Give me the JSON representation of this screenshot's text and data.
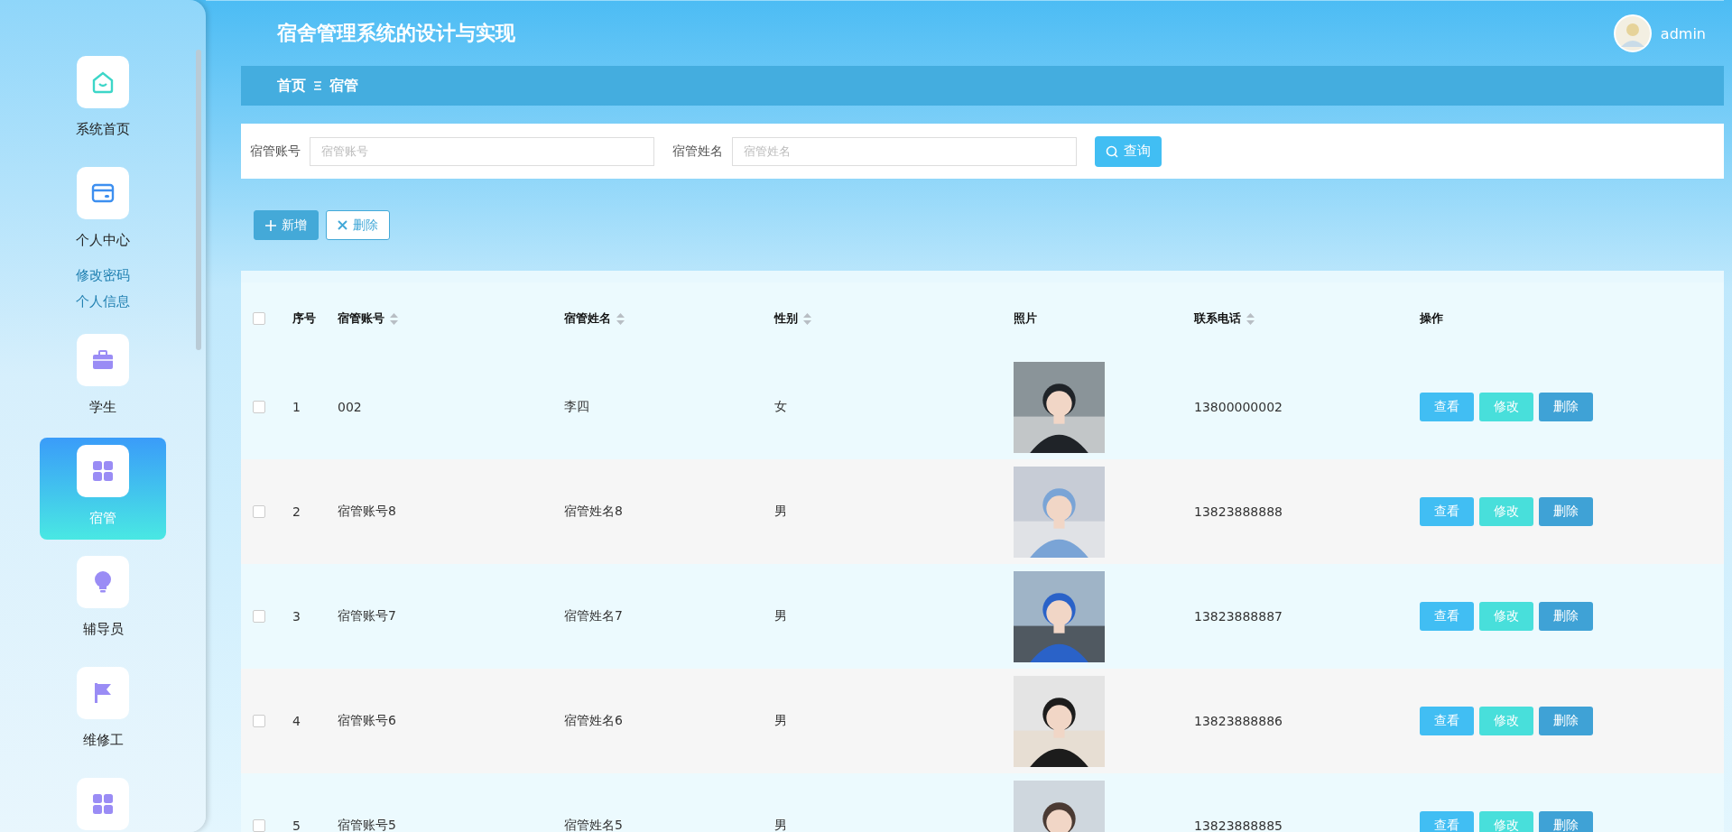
{
  "header": {
    "title": "宿舍管理系统的设计与实现",
    "user": "admin"
  },
  "sidebar": {
    "items": [
      {
        "label": "系统首页",
        "selected": false
      },
      {
        "label": "个人中心",
        "selected": false,
        "children": [
          {
            "label": "修改密码"
          },
          {
            "label": "个人信息"
          }
        ]
      },
      {
        "label": "学生",
        "selected": false
      },
      {
        "label": "宿管",
        "selected": true
      },
      {
        "label": "辅导员",
        "selected": false
      },
      {
        "label": "维修工",
        "selected": false
      },
      {
        "selected": false
      }
    ]
  },
  "breadcrumb": [
    "首页",
    "宿管"
  ],
  "search": {
    "fields": [
      {
        "label": "宿管账号",
        "placeholder": "宿管账号"
      },
      {
        "label": "宿管姓名",
        "placeholder": "宿管姓名"
      }
    ],
    "button": "查询"
  },
  "actions": [
    {
      "label": "新增",
      "kind": "add"
    },
    {
      "label": "删除",
      "kind": "delete"
    }
  ],
  "table": {
    "select_all": {
      "checked": false
    },
    "columns": [
      {
        "label": "序号",
        "sortable": false
      },
      {
        "label": "宿管账号",
        "sortable": true
      },
      {
        "label": "宿管姓名",
        "sortable": true
      },
      {
        "label": "性别",
        "sortable": true
      },
      {
        "label": "照片",
        "sortable": false
      },
      {
        "label": "联系电话",
        "sortable": true
      },
      {
        "label": "操作",
        "sortable": false
      }
    ],
    "rows": [
      {
        "checked": false,
        "index": "1",
        "account": "002",
        "name": "李四",
        "gender": "女",
        "phone": "13800000002",
        "actions": [
          "查看",
          "修改",
          "删除"
        ]
      },
      {
        "checked": false,
        "index": "2",
        "account": "宿管账号8",
        "name": "宿管姓名8",
        "gender": "男",
        "phone": "13823888888",
        "actions": [
          "查看",
          "修改",
          "删除"
        ]
      },
      {
        "checked": false,
        "index": "3",
        "account": "宿管账号7",
        "name": "宿管姓名7",
        "gender": "男",
        "phone": "13823888887",
        "actions": [
          "查看",
          "修改",
          "删除"
        ]
      },
      {
        "checked": false,
        "index": "4",
        "account": "宿管账号6",
        "name": "宿管姓名6",
        "gender": "男",
        "phone": "13823888886",
        "actions": [
          "查看",
          "修改",
          "删除"
        ]
      },
      {
        "checked": false,
        "index": "5",
        "account": "宿管账号5",
        "name": "宿管姓名5",
        "gender": "男",
        "phone": "13823888885",
        "actions": [
          "查看",
          "修改",
          "删除"
        ]
      }
    ]
  }
}
